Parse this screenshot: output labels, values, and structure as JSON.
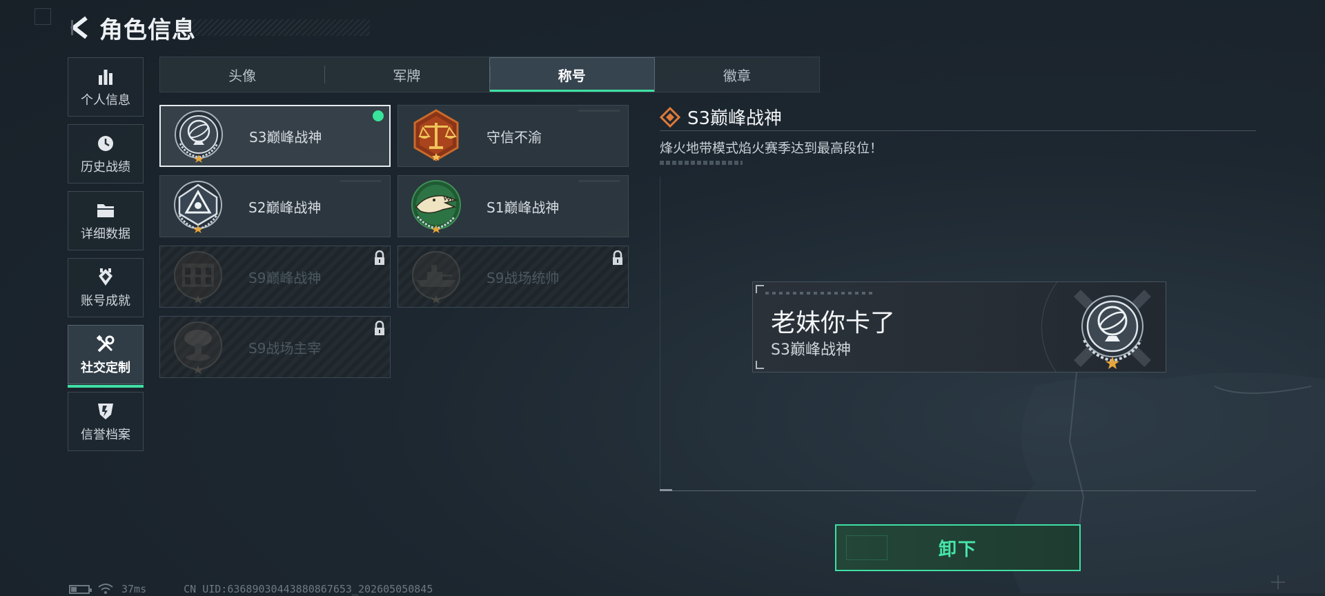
{
  "header": {
    "title": "角色信息"
  },
  "sidebar": {
    "items": [
      {
        "label": "个人信息",
        "icon": "bar-chart-icon"
      },
      {
        "label": "历史战绩",
        "icon": "history-clock-icon"
      },
      {
        "label": "详细数据",
        "icon": "folder-icon"
      },
      {
        "label": "账号成就",
        "icon": "achievement-icon"
      },
      {
        "label": "社交定制",
        "icon": "tools-icon",
        "active": true
      },
      {
        "label": "信誉档案",
        "icon": "credibility-shield-icon"
      }
    ]
  },
  "tabs": [
    {
      "label": "头像"
    },
    {
      "label": "军牌"
    },
    {
      "label": "称号",
      "active": true
    },
    {
      "label": "徽章"
    }
  ],
  "titles": [
    {
      "label": "S3巅峰战神",
      "badge": "armillary-sphere-badge",
      "equipped": true,
      "selected": true,
      "locked": false
    },
    {
      "label": "守信不渝",
      "badge": "scales-of-justice-badge",
      "equipped": false,
      "selected": false,
      "locked": false
    },
    {
      "label": "S2巅峰战神",
      "badge": "triangle-eye-badge",
      "equipped": false,
      "selected": false,
      "locked": false
    },
    {
      "label": "S1巅峰战神",
      "badge": "crocodile-badge",
      "equipped": false,
      "selected": false,
      "locked": false
    },
    {
      "label": "S9巅峰战神",
      "badge": "building-badge",
      "equipped": false,
      "selected": false,
      "locked": true
    },
    {
      "label": "S9战场统帅",
      "badge": "warship-badge",
      "equipped": false,
      "selected": false,
      "locked": true
    },
    {
      "label": "S9战场主宰",
      "badge": "mushroom-cloud-badge",
      "equipped": false,
      "selected": false,
      "locked": true
    }
  ],
  "detail": {
    "title": "S3巅峰战神",
    "description": "烽火地带模式焰火赛季达到最高段位！"
  },
  "nameplate": {
    "player_name": "老妹你卡了",
    "title": "S3巅峰战神"
  },
  "action": {
    "unequip_label": "卸下"
  },
  "status": {
    "ping": "37ms",
    "uid": "CN UID:6368903044388086765З_202605050845"
  },
  "colors": {
    "accent": "#3fe0a4",
    "equipped_dot": "#38e39a",
    "detail_icon": "#e07a3a",
    "badge_star": "#e8a53a"
  }
}
